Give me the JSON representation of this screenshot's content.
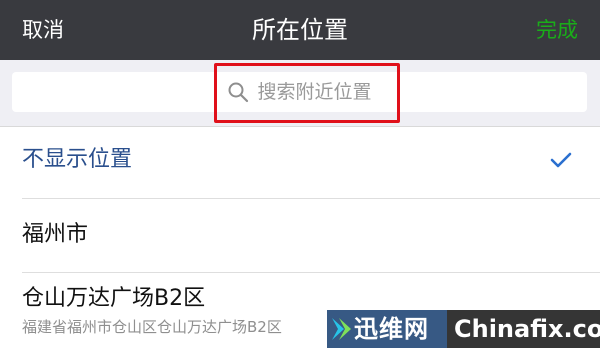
{
  "nav": {
    "cancel_label": "取消",
    "title": "所在位置",
    "done_label": "完成",
    "done_color": "#1aad19"
  },
  "search": {
    "placeholder": "搜索附近位置",
    "icon": "search-icon",
    "highlight_color": "#e0101a"
  },
  "locations": [
    {
      "name": "不显示位置",
      "selected": true,
      "check_icon": "checkmark-icon"
    },
    {
      "name": "福州市"
    },
    {
      "name": "仓山万达广场B2区",
      "address": "福建省福州市仓山区仓山万达广场B2区"
    }
  ],
  "watermark": {
    "logo_text": "迅维网",
    "site_text": "Chinafix.com"
  }
}
